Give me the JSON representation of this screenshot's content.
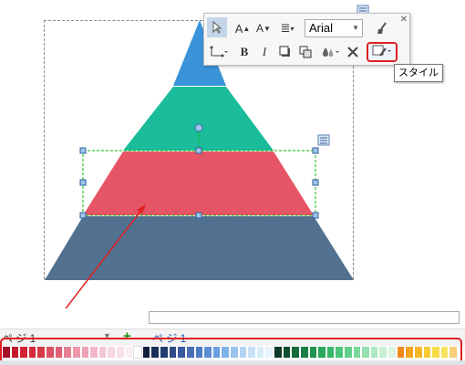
{
  "toolbar": {
    "font_name": "Arial",
    "tooltip": "スタイル"
  },
  "page_bar": {
    "page_select_label": "ぺ ジ 1",
    "page_tab": "ぺ ジ 1"
  },
  "colors": {
    "pyramid_top": "#3a93d8",
    "pyramid_teal": "#1bbc9b",
    "pyramid_red": "#e65565",
    "pyramid_bottom": "#52708f",
    "selection_green": "#00bb00",
    "highlight_red": "#e02020"
  },
  "icons": {
    "pointer": "pointer-icon",
    "font_grow": "font-grow-icon",
    "font_shrink": "font-shrink-icon",
    "align": "align-icon",
    "brush": "brush-icon",
    "connector": "connector-icon",
    "bold": "bold-icon",
    "italic": "italic-icon",
    "shadow": "shadow-icon",
    "copy_format": "copy-format-icon",
    "fill": "fill-icon",
    "tools": "tools-icon",
    "style": "style-icon"
  },
  "palette_colors": [
    "#a50f2a",
    "#c2182c",
    "#d32232",
    "#d42b3a",
    "#d33a46",
    "#d95363",
    "#e06173",
    "#e58094",
    "#ec98aa",
    "#eaa2b4",
    "#f1b6c6",
    "#f2c7d3",
    "#f6d6e0",
    "#f8e2ea",
    "#fbeef3",
    "#ffffff",
    "#101f3c",
    "#1a2f57",
    "#203b6e",
    "#2d4a86",
    "#395a9e",
    "#4b6fb5",
    "#4d7cc3",
    "#5d8ed4",
    "#6aa0e0",
    "#7fb3e8",
    "#9ac4ee",
    "#b2d4f2",
    "#c8e1f6",
    "#d8ebf9",
    "#e8f3fc",
    "#0c3a25",
    "#0f4f2f",
    "#156a3c",
    "#1a7f45",
    "#229350",
    "#2ba65d",
    "#38b66a",
    "#4cc47c",
    "#62ce8b",
    "#7cd89d",
    "#95dfae",
    "#aee7c0",
    "#c7efd2",
    "#dcf5e3",
    "#f08a1c",
    "#f3a31f",
    "#f5b728",
    "#f6cb33",
    "#f7db45",
    "#f7e35e",
    "#f5cf7a"
  ]
}
